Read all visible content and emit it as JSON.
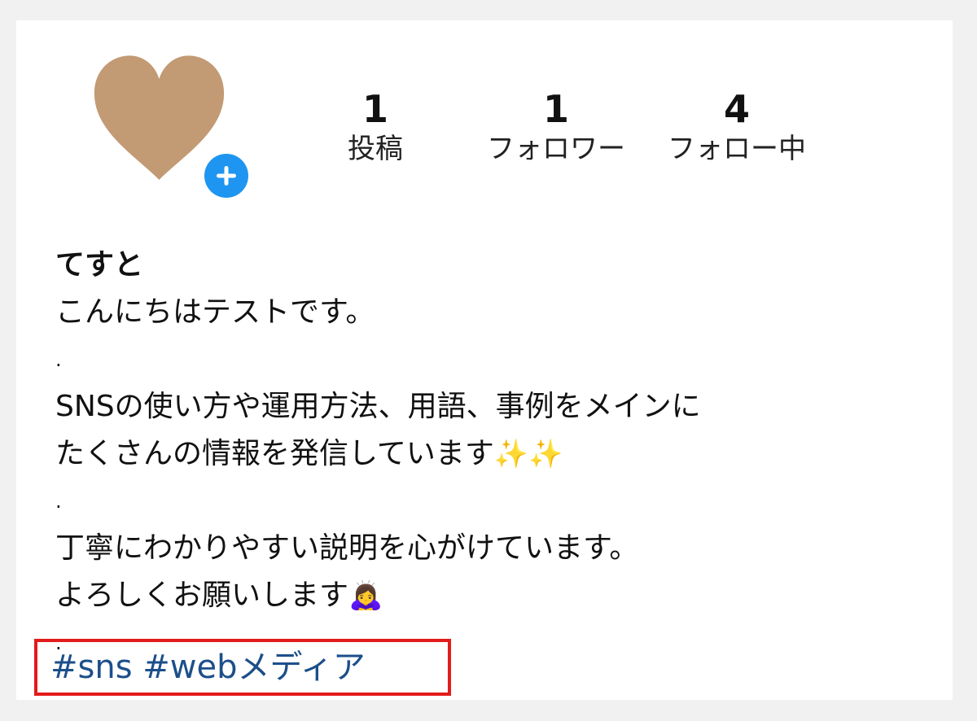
{
  "profile": {
    "avatar_icon": "heart-icon",
    "avatar_color": "#c29a74",
    "add_icon": "plus-icon",
    "add_color": "#1e95f0",
    "stats": [
      {
        "value": "1",
        "label": "投稿"
      },
      {
        "value": "1",
        "label": "フォロワー"
      },
      {
        "value": "4",
        "label": "フォロー中"
      }
    ],
    "username": "てすと",
    "bio": {
      "line1": "こんにちはテストです。",
      "dot1": ".",
      "line2": "SNSの使い方や運用方法、用語、事例をメインに",
      "line3": "たくさんの情報を発信しています",
      "line3_emoji": "✨✨",
      "dot2": ".",
      "line4": "丁寧にわかりやすい説明を心がけています。",
      "line5": "よろしくお願いします",
      "line5_emoji": "🙇‍♀️",
      "dot3": "."
    },
    "hashtags": [
      "#sns",
      "#webメディア"
    ],
    "highlight_color": "#e31b1b",
    "hashtag_color": "#1c4f8a"
  }
}
